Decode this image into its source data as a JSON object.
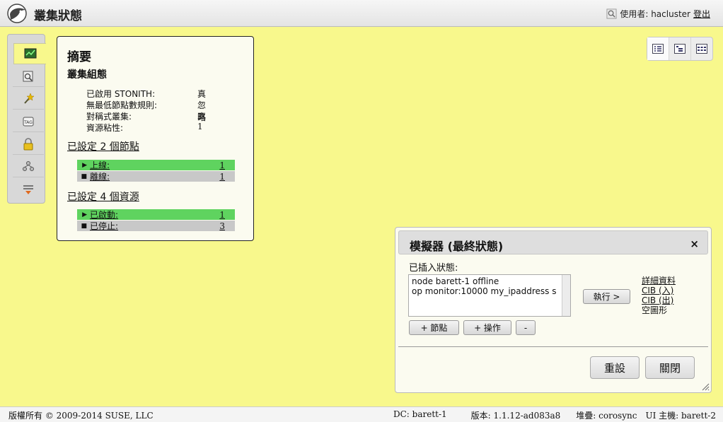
{
  "header": {
    "title": "叢集狀態",
    "user_label": "使用者: hacluster",
    "logout": "登出"
  },
  "sidebar": {
    "items": [
      {
        "icon": "dashboard-icon",
        "active": true
      },
      {
        "icon": "history-search-icon",
        "active": false
      },
      {
        "icon": "wand-icon",
        "active": false
      },
      {
        "icon": "tags-icon",
        "active": false
      },
      {
        "icon": "lock-icon",
        "active": false
      },
      {
        "icon": "access-control-icon",
        "active": false
      },
      {
        "icon": "dependencies-icon",
        "active": false
      }
    ]
  },
  "summary": {
    "title": "摘要",
    "config_heading": "叢集組態",
    "config": [
      {
        "label": "已啟用 STONITH:",
        "value": "真"
      },
      {
        "label": "無最低節點數規則:",
        "value": "忽略"
      },
      {
        "label": "對稱式叢集:",
        "value": "真"
      },
      {
        "label": "資源粘性:",
        "value": "1"
      }
    ],
    "nodes_heading": "已設定 2 個節點",
    "nodes": [
      {
        "label": "上線:",
        "count": "1",
        "state": "green",
        "bullet": "▶"
      },
      {
        "label": "離線:",
        "count": "1",
        "state": "gray",
        "bullet": "■"
      }
    ],
    "resources_heading": "已設定 4 個資源",
    "resources": [
      {
        "label": "已啟動:",
        "count": "1",
        "state": "green",
        "bullet": "▶"
      },
      {
        "label": "已停止:",
        "count": "3",
        "state": "gray",
        "bullet": "■"
      }
    ]
  },
  "simulator": {
    "title": "模擬器 (最終狀態)",
    "close_symbol": "×",
    "injected_label": "已插入狀態:",
    "injected_lines": [
      "node barett-1 offline",
      "op monitor:10000 my_ipaddress s"
    ],
    "run_button": "執行 >",
    "add_node_button": "+ 節點",
    "add_op_button": "+ 操作",
    "remove_button": "-",
    "links": {
      "details": "詳細資料",
      "cib_in": "CIB (入)",
      "cib_out": "CIB (出)",
      "graph": "空圖形"
    },
    "reset_button": "重設",
    "close_button": "關閉"
  },
  "footer": {
    "copyright": "版權所有 © 2009-2014 SUSE, LLC",
    "dc": "DC: barett-1",
    "version": "版本: 1.1.12-ad083a8",
    "stack": "堆疊: corosync",
    "host": "UI 主機: barett-2"
  },
  "colors": {
    "background": "#f8f88c",
    "online_green": "#5fd35f",
    "offline_gray": "#c8c8c8"
  }
}
